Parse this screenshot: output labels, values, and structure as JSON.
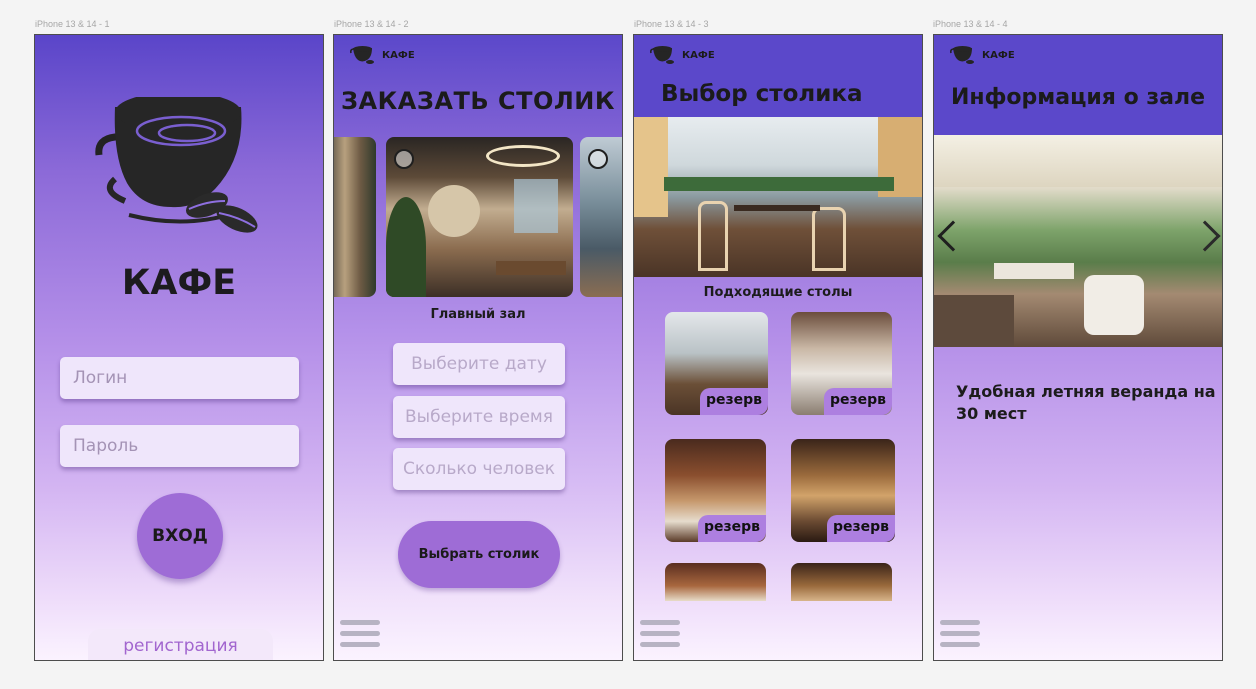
{
  "frames": [
    "iPhone 13 & 14 - 1",
    "iPhone 13 & 14 - 2",
    "iPhone 13 & 14 - 3",
    "iPhone 13 & 14 - 4"
  ],
  "brand": "КАФЕ",
  "login": {
    "title": "КАФЕ",
    "login_placeholder": "Логин",
    "password_placeholder": "Пароль",
    "enter_button": "ВХОД",
    "register_link": "регистрация"
  },
  "booking": {
    "title": "ЗАКАЗАТЬ СТОЛИК",
    "hall_caption": "Главный зал",
    "date_placeholder": "Выберите дату",
    "time_placeholder": "Выберите время",
    "guests_placeholder": "Сколько человек",
    "choose_button": "Выбрать столик"
  },
  "tables": {
    "title": "Выбор столика",
    "subtitle": "Подходящие столы",
    "items": [
      {
        "badge": "резерв"
      },
      {
        "badge": "резерв"
      },
      {
        "badge": "резерв"
      },
      {
        "badge": "резерв"
      }
    ]
  },
  "hall_info": {
    "title": "Информация о зале",
    "description": "Удобная летняя веранда на 30 мест"
  },
  "colors": {
    "header": "#5b48ca",
    "accent": "#9b6bd5",
    "badge": "#ad7fe0"
  }
}
